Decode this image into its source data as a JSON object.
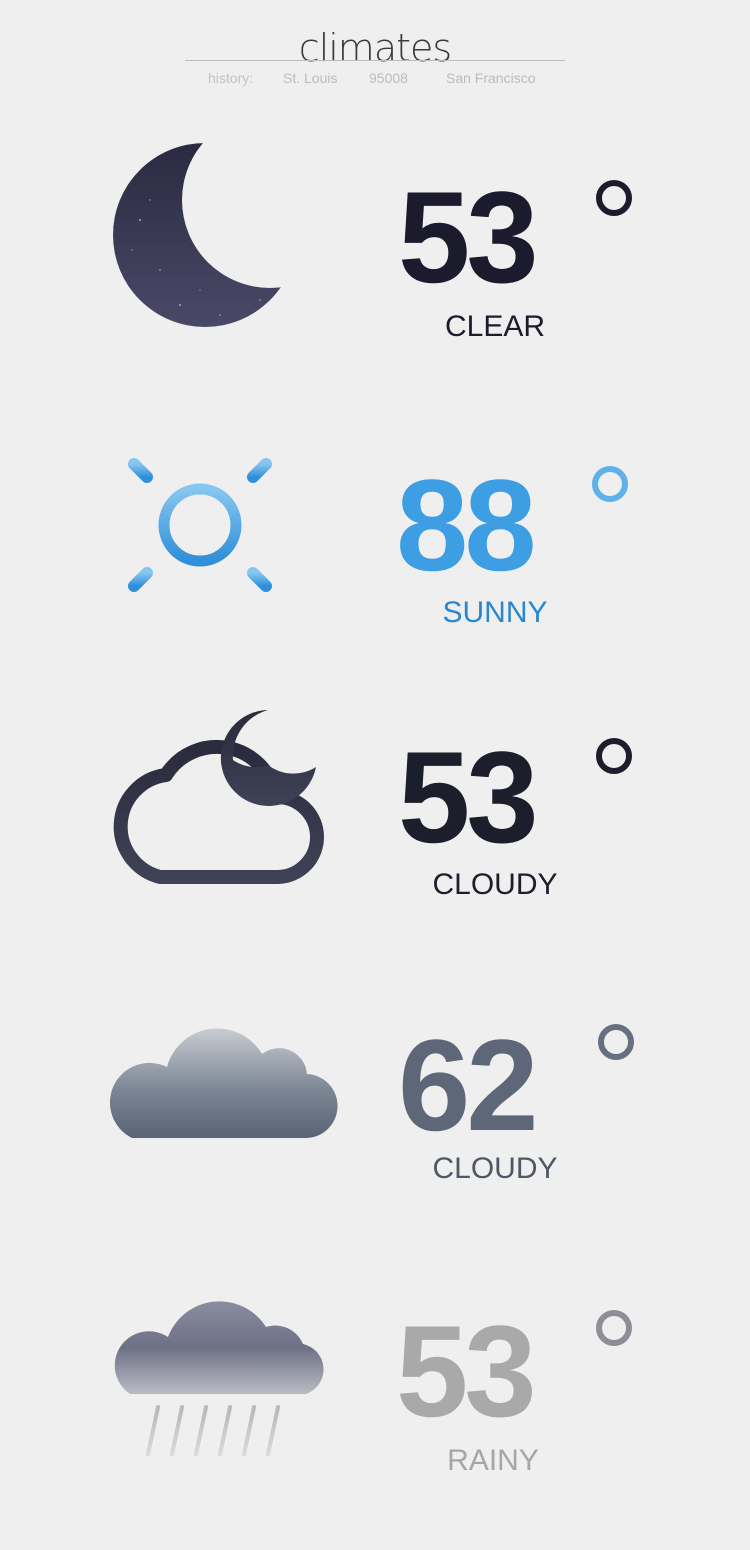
{
  "header": {
    "title": "climates",
    "history_label": "history:",
    "history_items": [
      "St. Louis",
      "95008",
      "San Francisco"
    ]
  },
  "colors": {
    "night": "#1c1b2e",
    "sunny": "#3d9ee4",
    "cloudy_night": "#1d1e2b",
    "overcast": "#5d6777",
    "rainy": "#a9a9a9",
    "accent": "#6dc3ee"
  },
  "forecasts": [
    {
      "icon": "moon-icon",
      "temp": "53",
      "condition": "CLEAR"
    },
    {
      "icon": "sun-icon",
      "temp": "88",
      "condition": "SUNNY"
    },
    {
      "icon": "cloud-moon-icon",
      "temp": "53",
      "condition": "CLOUDY"
    },
    {
      "icon": "cloud-icon",
      "temp": "62",
      "condition": "CLOUDY"
    },
    {
      "icon": "rain-cloud-icon",
      "temp": "53",
      "condition": "RAINY"
    }
  ]
}
